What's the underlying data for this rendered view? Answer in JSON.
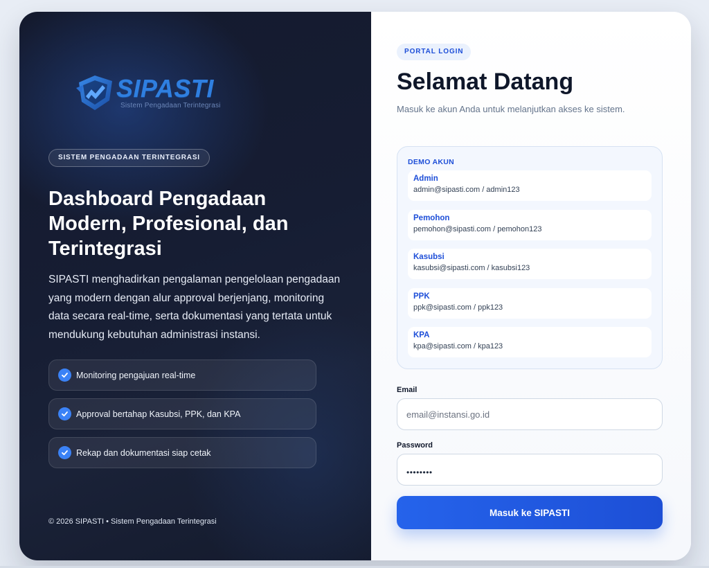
{
  "brand": {
    "name": "SIPASTI",
    "tagline": "Sistem Pengadaan Terintegrasi"
  },
  "hero": {
    "badge": "SISTEM PENGADAAN TERINTEGRASI",
    "title": "Dashboard Pengadaan Modern, Profesional, dan Terintegrasi",
    "description": "SIPASTI menghadirkan pengalaman pengelolaan pengadaan yang modern dengan alur approval berjenjang, monitoring data secara real-time, serta dokumentasi yang tertata untuk mendukung kebutuhan administrasi instansi.",
    "features": [
      {
        "label": "Monitoring pengajuan real-time",
        "icon": "check-circle-icon"
      },
      {
        "label": "Approval bertahap Kasubsi, PPK, dan KPA",
        "icon": "check-circle-icon"
      },
      {
        "label": "Rekap dan dokumentasi siap cetak",
        "icon": "check-circle-icon"
      }
    ],
    "copyright": "© 2026 SIPASTI • Sistem Pengadaan Terintegrasi"
  },
  "login": {
    "badge": "PORTAL LOGIN",
    "title": "Selamat Datang",
    "subtitle": "Masuk ke akun Anda untuk melanjutkan akses ke sistem.",
    "demo": {
      "title": "DEMO AKUN",
      "accounts": [
        {
          "role": "Admin",
          "credentials": "admin@sipasti.com / admin123"
        },
        {
          "role": "Pemohon",
          "credentials": "pemohon@sipasti.com / pemohon123"
        },
        {
          "role": "Kasubsi",
          "credentials": "kasubsi@sipasti.com / kasubsi123"
        },
        {
          "role": "PPK",
          "credentials": "ppk@sipasti.com / ppk123"
        },
        {
          "role": "KPA",
          "credentials": "kpa@sipasti.com / kpa123"
        }
      ]
    },
    "email": {
      "label": "Email",
      "placeholder": "email@instansi.go.id",
      "value": ""
    },
    "password": {
      "label": "Password",
      "masked_value": "••••••••"
    },
    "submit_label": "Masuk ke SIPASTI"
  },
  "colors": {
    "accent": "#2563eb",
    "dark_panel": "#141a2e",
    "check": "#3b82f6"
  }
}
